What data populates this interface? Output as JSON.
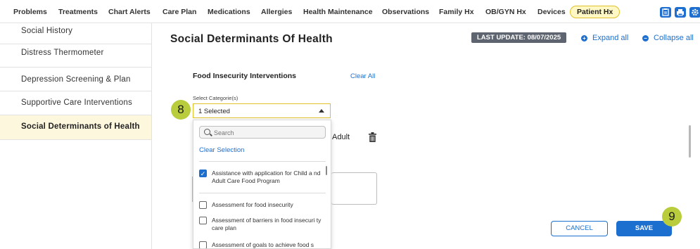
{
  "nav": {
    "tabs": [
      "Problems",
      "Treatments",
      "Chart Alerts",
      "Care Plan",
      "Medications",
      "Allergies",
      "Health Maintenance",
      "Observations",
      "Family Hx",
      "OB/GYN Hx",
      "Devices",
      "Patient Hx"
    ],
    "active_tab": "Patient Hx",
    "icons": [
      "clipboard-icon",
      "print-icon",
      "gear-icon"
    ]
  },
  "sidebar": {
    "items": [
      {
        "label": "Social History"
      },
      {
        "label": "Distress Thermometer"
      },
      {
        "label": "Depression Screening & Plan"
      },
      {
        "label": "Supportive Care Interventions"
      },
      {
        "label": "Social Determinants of Health"
      }
    ],
    "active_item": "Social Determinants of Health"
  },
  "main": {
    "title": "Social Determinants Of Health",
    "last_update": "LAST UPDATE: 08/07/2025",
    "expand_all": "Expand all",
    "collapse_all": "Collapse all",
    "section_title": "Food Insecurity Interventions",
    "clear_all": "Clear All",
    "select_label": "Select Categorie(s)",
    "select_value": "1 Selected",
    "adult_text": "Adult",
    "cancel_label": "CANCEL",
    "save_label": "SAVE",
    "step_badges": [
      "8",
      "9"
    ]
  },
  "dropdown": {
    "search_placeholder": "Search",
    "clear_selection": "Clear Selection",
    "options": [
      {
        "label": "Assistance with application for Child a nd Adult Care Food Program",
        "checked": true
      },
      {
        "label": "Assessment for food insecurity",
        "checked": false
      },
      {
        "label": "Assessment of barriers in food insecuri ty care plan",
        "checked": false
      },
      {
        "label": "Assessment of goals to achieve food s",
        "checked": false
      }
    ]
  },
  "colors": {
    "accent": "#1d6fcf",
    "highlight": "#e0c12a",
    "badge": "#b8cc3c",
    "active_bg": "#fdf7de"
  }
}
